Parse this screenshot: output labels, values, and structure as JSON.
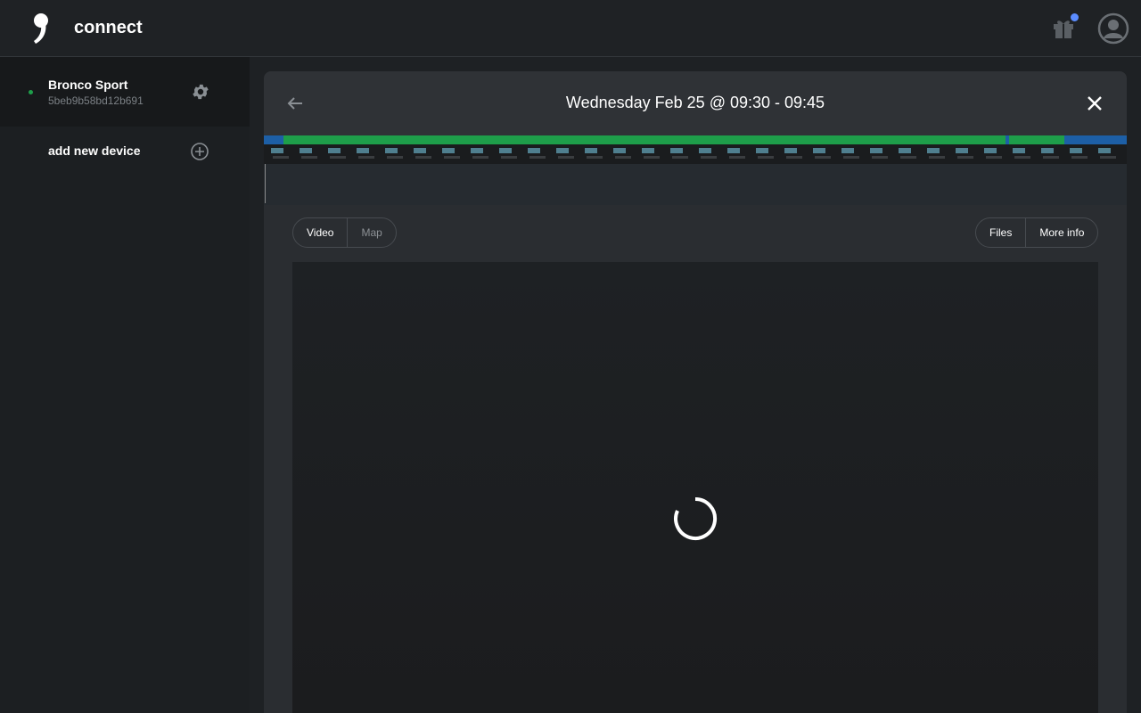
{
  "header": {
    "app_name": "connect"
  },
  "sidebar": {
    "device": {
      "name": "Bronco Sport",
      "id": "5beb9b58bd12b691"
    },
    "add_label": "add new device"
  },
  "drive": {
    "title": "Wednesday Feb 25 @ 09:30 - 09:45",
    "tabs_left": [
      "Video",
      "Map"
    ],
    "tabs_right": [
      "Files",
      "More info"
    ]
  },
  "colors": {
    "engaged": "#1e9e4a",
    "timeline_blue": "#1d5fa6",
    "accent_dot": "#5b8cff"
  }
}
